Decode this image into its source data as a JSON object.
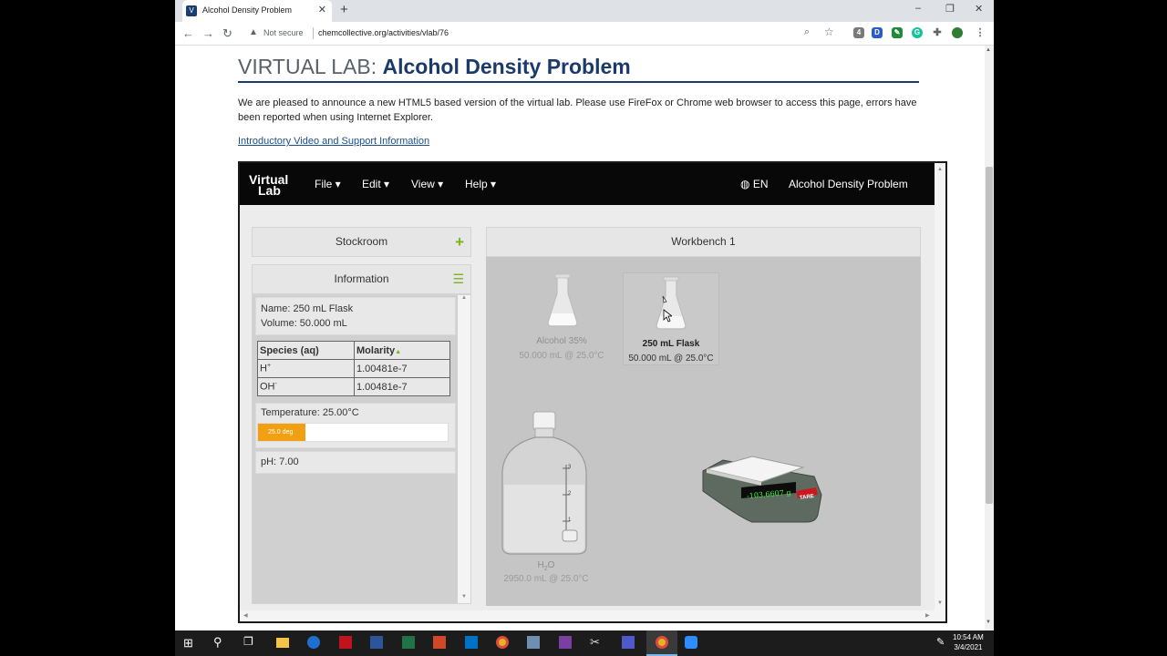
{
  "browser": {
    "tab_title": "Alcohol Density Problem",
    "tab_close": "✕",
    "new_tab": "+",
    "security_label": "Not secure",
    "url": "chemcollective.org/activities/vlab/76",
    "window_minimize": "–",
    "window_maximize": "❐",
    "window_close": "✕",
    "extension_badge": "4",
    "extension_d": "D"
  },
  "page": {
    "heading_prefix": "VIRTUAL LAB:",
    "heading_main": "Alcohol Density Problem",
    "announcement": "We are pleased to announce a new HTML5 based version of the virtual lab. Please use FireFox or Chrome web browser to access this page, errors have been reported when using Internet Explorer.",
    "intro_link": "Introductory Video and Support Information"
  },
  "vlab": {
    "logo_line1": "Virtual",
    "logo_line2": "Lab",
    "menu": [
      "File",
      "Edit",
      "View",
      "Help"
    ],
    "language": "EN",
    "problem_title": "Alcohol Density Problem",
    "stockroom_label": "Stockroom",
    "information_label": "Information",
    "workbench_label": "Workbench 1",
    "info": {
      "name": "Name: 250 mL Flask",
      "volume": "Volume: 50.000 mL",
      "species_header": "Species (aq)",
      "molarity_header": "Molarity",
      "species": [
        {
          "name": "H",
          "sup": "+",
          "molarity": "1.00481e-7"
        },
        {
          "name": "OH",
          "sup": "-",
          "molarity": "1.00481e-7"
        }
      ],
      "temperature": "Temperature: 25.00°C",
      "temp_bar_label": "25.0 deg",
      "temp_fraction": 0.25,
      "ph": "pH: 7.00"
    },
    "workbench": {
      "items": [
        {
          "name": "Alcohol 35%",
          "detail": "50.000 mL @ 25.0°C",
          "selected": false
        },
        {
          "name": "250 mL Flask",
          "detail": "50.000 mL @ 25.0°C",
          "selected": true
        }
      ],
      "water": {
        "name_main": "H",
        "name_sub": "2",
        "name_tail": "O",
        "detail": "2950.0 mL @ 25.0°C",
        "scale_marks": [
          "3",
          "2",
          "1"
        ]
      },
      "scale": {
        "reading": "-103.6607 g",
        "tare_label": "TARE"
      }
    }
  },
  "taskbar": {
    "time": "10:54 AM",
    "date": "3/4/2021",
    "apps": [
      "start",
      "search",
      "task-view",
      "file-explorer",
      "edge",
      "acrobat",
      "word",
      "excel",
      "powerpoint",
      "outlook",
      "chrome",
      "remote-desktop",
      "app-tool",
      "snipping-tool",
      "teams",
      "chrome-active",
      "zoom"
    ]
  },
  "colors": {
    "heading_accent": "#1b3a6b",
    "link": "#1b4f8a",
    "add_icon": "#7ab317",
    "temp_fill": "#f0a010",
    "scale_display": "#3dff3d",
    "tare_button": "#c8191f"
  }
}
